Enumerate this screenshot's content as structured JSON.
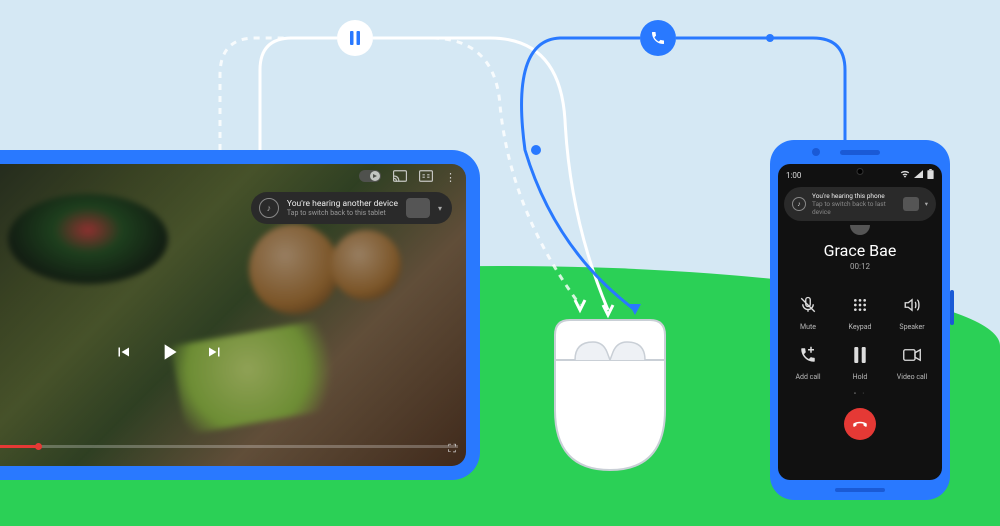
{
  "tablet": {
    "toast_title": "You're hearing another device",
    "toast_sub": "Tap to switch back to this tablet"
  },
  "phone": {
    "time": "1:00",
    "toast_title": "You're hearing this phone",
    "toast_sub": "Tap to switch back to last device",
    "caller_name": "Grace Bae",
    "call_duration": "00:12",
    "buttons": {
      "mute": "Mute",
      "keypad": "Keypad",
      "speaker": "Speaker",
      "add_call": "Add call",
      "hold": "Hold",
      "video_call": "Video call"
    }
  },
  "colors": {
    "accent_blue": "#2979ff",
    "ground_green": "#2bd056",
    "sky": "#d5e8f4",
    "end_call": "#e53935"
  }
}
